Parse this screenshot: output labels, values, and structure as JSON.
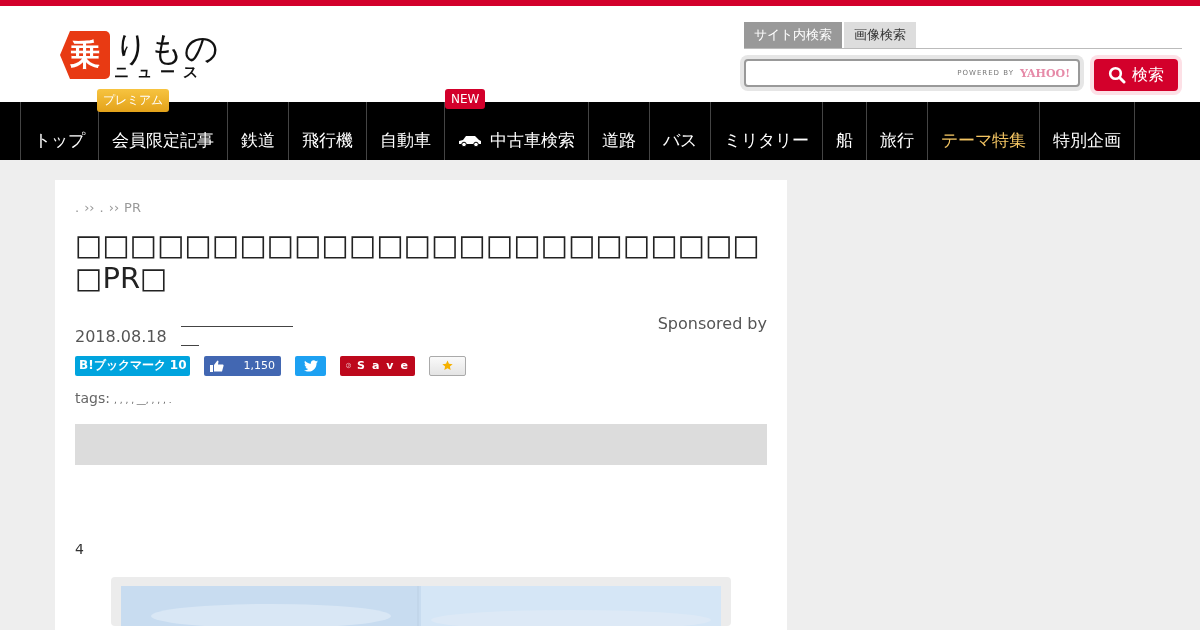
{
  "logo": {
    "mark": "乗",
    "name": "りもの",
    "sub": "ニュース"
  },
  "search": {
    "tabs": [
      {
        "label": "サイト内検索",
        "selected": true
      },
      {
        "label": "画像検索",
        "selected": false
      }
    ],
    "powered_by": "POWERED BY",
    "provider": "YAHOO!",
    "button": "検索"
  },
  "nav": {
    "items": [
      {
        "label": "トップ",
        "kind": "plain"
      },
      {
        "label": "会員限定記事",
        "kind": "plain",
        "badge": "プレミアム"
      },
      {
        "label": "鉄道",
        "kind": "plain"
      },
      {
        "label": "飛行機",
        "kind": "plain"
      },
      {
        "label": "自動車",
        "kind": "plain"
      },
      {
        "label": "中古車検索",
        "kind": "car",
        "badge": "NEW"
      },
      {
        "label": "道路",
        "kind": "plain"
      },
      {
        "label": "バス",
        "kind": "plain"
      },
      {
        "label": "ミリタリー",
        "kind": "plain"
      },
      {
        "label": "船",
        "kind": "plain"
      },
      {
        "label": "旅行",
        "kind": "plain"
      },
      {
        "label": "テーマ特集",
        "kind": "highlight"
      },
      {
        "label": "特別企画",
        "kind": "plain"
      }
    ]
  },
  "article": {
    "breadcrumb": [
      ".",
      "››",
      ".",
      "››",
      "PR"
    ],
    "title": "□□□□□□□□□□□□□□□□□□□□□□□□□□PR□",
    "sponsored": "Sponsored by",
    "date": "2018.08.18",
    "share": [
      {
        "kind": "hatena",
        "label": "B!ブックマーク 10"
      },
      {
        "kind": "facebook",
        "label": "1,150"
      },
      {
        "kind": "twitter"
      },
      {
        "kind": "pinterest",
        "label": "Save"
      },
      {
        "kind": "star"
      }
    ],
    "tags_label": "tags:",
    "tags": ", , , , __, , , , .",
    "paragraph": "4"
  }
}
